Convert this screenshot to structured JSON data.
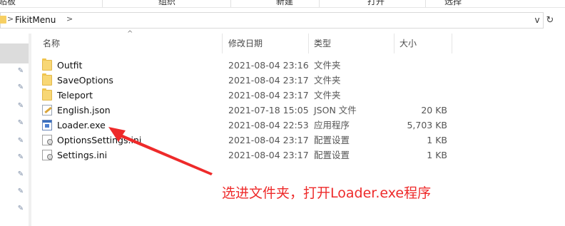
{
  "ribbon": {
    "groups": [
      "剪贴板",
      "组织",
      "新建",
      "打开",
      "选择"
    ]
  },
  "address": {
    "crumb": "FikitMenu",
    "separator": ">",
    "dropdown_glyph": "v",
    "refresh_glyph": "↻"
  },
  "columns": {
    "name": "名称",
    "date": "修改日期",
    "type": "类型",
    "size": "大小"
  },
  "files": [
    {
      "name": "Outfit",
      "date": "2021-08-04 23:16",
      "type": "文件夹",
      "size": "",
      "icon": "folder-icon"
    },
    {
      "name": "SaveOptions",
      "date": "2021-08-04 23:17",
      "type": "文件夹",
      "size": "",
      "icon": "folder-icon"
    },
    {
      "name": "Teleport",
      "date": "2021-08-04 23:17",
      "type": "文件夹",
      "size": "",
      "icon": "folder-icon"
    },
    {
      "name": "English.json",
      "date": "2021-07-18 15:05",
      "type": "JSON 文件",
      "size": "20 KB",
      "icon": "json-file-icon"
    },
    {
      "name": "Loader.exe",
      "date": "2021-08-04 22:53",
      "type": "应用程序",
      "size": "5,703 KB",
      "icon": "exe-file-icon"
    },
    {
      "name": "OptionsSettings.ini",
      "date": "2021-08-04 23:17",
      "type": "配置设置",
      "size": "1 KB",
      "icon": "ini-file-icon"
    },
    {
      "name": "Settings.ini",
      "date": "2021-08-04 23:17",
      "type": "配置设置",
      "size": "1 KB",
      "icon": "ini-file-icon"
    }
  ],
  "annotation": {
    "text": "选进文件夹，打开Loader.exe程序",
    "color": "#ee2a2a"
  },
  "colors": {
    "folder": "#f8d775",
    "nav_selected": "#dcdcdc"
  }
}
